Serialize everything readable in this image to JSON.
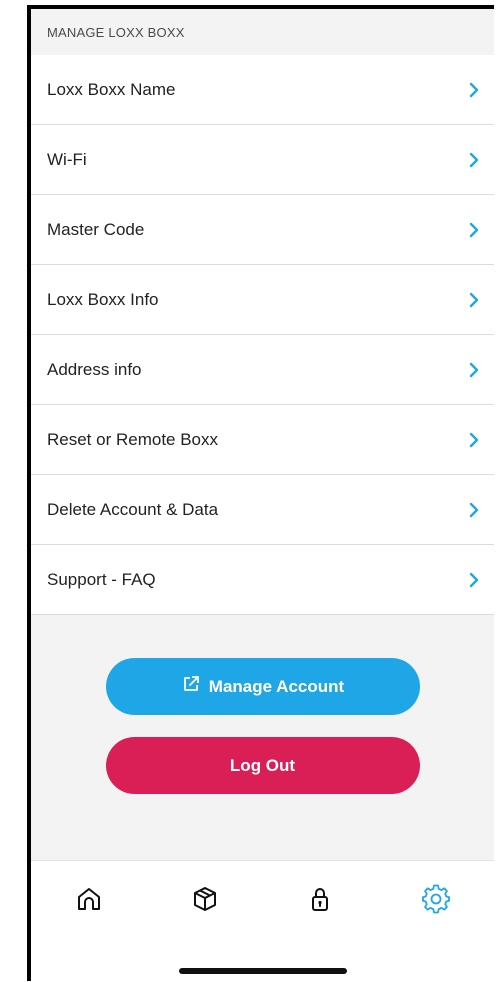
{
  "section": {
    "title": "MANAGE LOXX BOXX"
  },
  "menu": [
    {
      "label": "Loxx Boxx Name"
    },
    {
      "label": "Wi-Fi"
    },
    {
      "label": "Master Code"
    },
    {
      "label": "Loxx Boxx Info"
    },
    {
      "label": "Address info"
    },
    {
      "label": "Reset or Remote Boxx"
    },
    {
      "label": "Delete Account & Data"
    },
    {
      "label": "Support - FAQ"
    }
  ],
  "buttons": {
    "manage_account": "Manage Account",
    "log_out": "Log Out"
  },
  "tabs": [
    {
      "icon": "home-icon"
    },
    {
      "icon": "box-icon"
    },
    {
      "icon": "lock-icon"
    },
    {
      "icon": "gear-icon",
      "active": true
    }
  ],
  "colors": {
    "accent": "#1fa6e6",
    "danger": "#da1f57",
    "background": "#f3f3f4"
  }
}
